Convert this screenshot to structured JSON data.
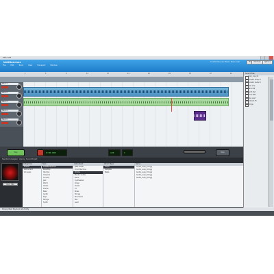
{
  "window": {
    "title": "Mixcraft"
  },
  "app": {
    "title": "Untitled.mxx",
    "tagline": "Customize your Music. Now now!"
  },
  "header_buttons": {
    "mix": "Mix",
    "mixdown": "Mixdown",
    "options": "Options"
  },
  "menu": [
    "File",
    "Edit",
    "Track",
    "View",
    "Transport",
    "Window"
  ],
  "ruler_marks": [
    "1",
    "5",
    "9",
    "13",
    "17",
    "21",
    "25",
    "29",
    "33",
    "37",
    "41"
  ],
  "tracks": [
    {
      "name": "Track 1"
    },
    {
      "name": "Track 2"
    },
    {
      "name": "Track 3"
    },
    {
      "name": "Track 4"
    },
    {
      "name": "Track 5"
    }
  ],
  "transport": {
    "play_label": "Play",
    "record_label": "Record",
    "counter": "0:00.000",
    "tempo": "120",
    "key": "C",
    "stop_label": "Stop"
  },
  "loopbar": {
    "left": "Spectrum Analyzer",
    "mid": "Library",
    "right": "Sound Project"
  },
  "library": {
    "thumb_label": "Rock Hits",
    "columns": [
      {
        "header": "Categories",
        "rows": [
          "Drums",
          "Instrument",
          "All Loops"
        ],
        "selected": 0
      },
      {
        "header": "Type",
        "rows": [
          "Acid/Electronica",
          "Rock/Pop",
          "Hip-Hop",
          "Classical",
          "Country",
          "Jazz",
          "World",
          "Vocals",
          "Drums",
          "Bass",
          "Guitar",
          "Keys",
          "Strings",
          "Synth"
        ],
        "selected": 0
      },
      {
        "header": "Instrument",
        "rows": [
          "Bass Guitar",
          "Drum Machine",
          "Drums",
          "Electric Guitar",
          "Piano",
          "Synthesizer",
          "Organ",
          "Vocals",
          "FX",
          "Brass",
          "Strings",
          "Percussion",
          "Pad",
          "Lead"
        ],
        "selected": 2
      },
      {
        "header": "Album Type",
        "rows": [
          "Loops",
          "Samples",
          "Beats"
        ],
        "selected": 0
      },
      {
        "header": "Name",
        "rows": [
          "Guitar_Loop_01.ogg",
          "Guitar_Loop_02.ogg",
          "Guitar_Loop_03.ogg",
          "Guitar_Loop_04.ogg",
          "Guitar_Loop_05.ogg"
        ],
        "selected": -1
      }
    ]
  },
  "status": {
    "text": "Playing Beat Playback lets Pretty"
  },
  "sidepanel": {
    "header": "Sound Files",
    "rows": [
      "drum_loop_01",
      "Acoustic Guitar 1",
      "Acoustic Guitar 2",
      "Bass Line",
      "Piano Riff",
      "Synth Pad",
      "Vocal Take",
      "Keys Lead",
      "Ambient FX",
      "Strings"
    ]
  },
  "colors": {
    "accent": "#1f7cc9",
    "clip_blue": "#4a90c0",
    "clip_green": "#a9d9a0",
    "clip_purple": "#5a2c8c",
    "playhead": "#e84a3c"
  }
}
